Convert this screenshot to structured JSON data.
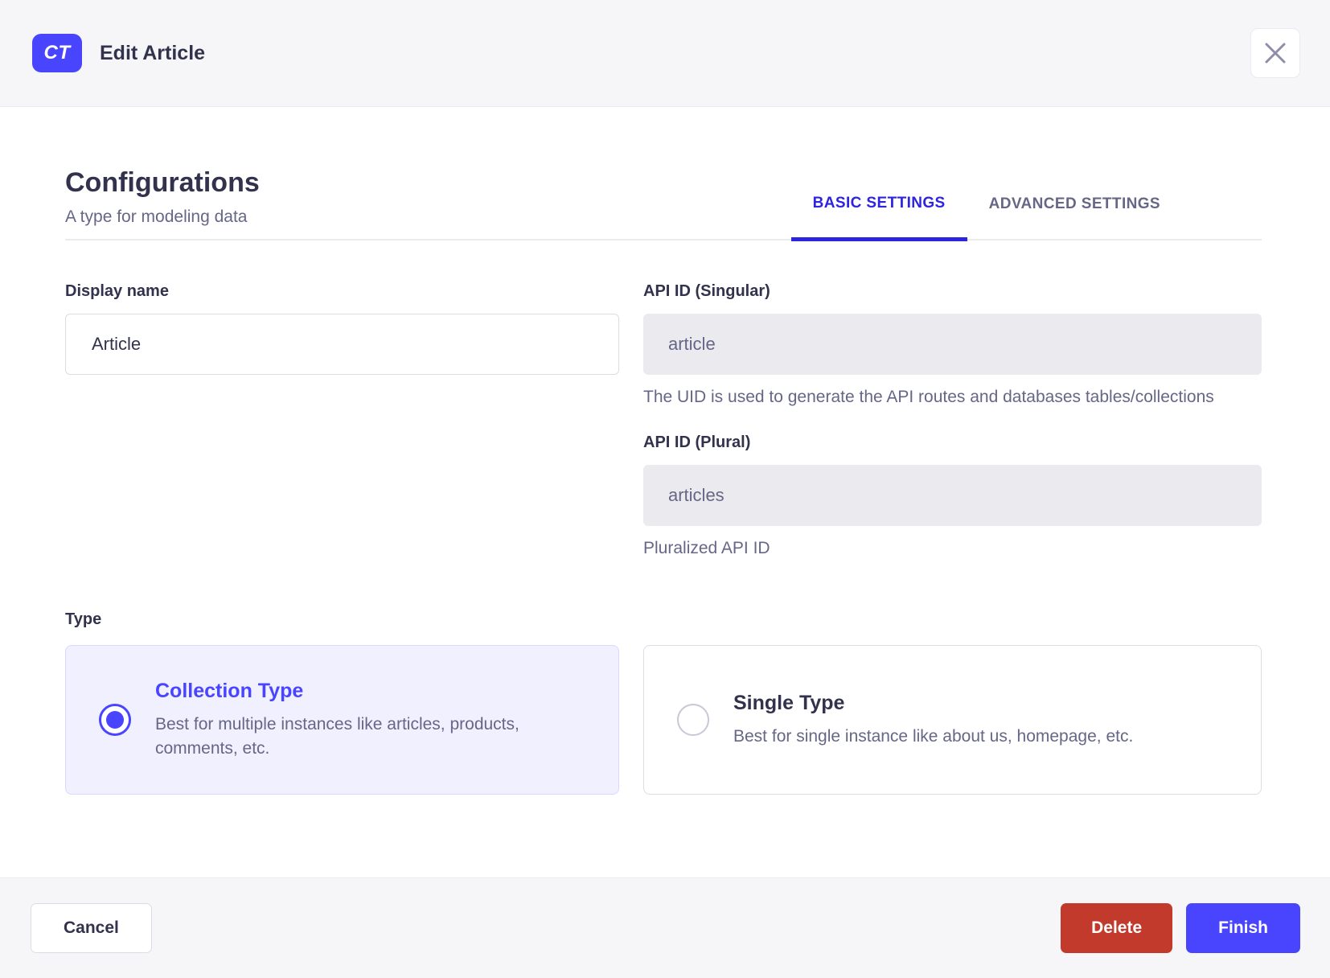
{
  "header": {
    "badge": "CT",
    "title": "Edit Article"
  },
  "config": {
    "title": "Configurations",
    "subtitle": "A type for modeling data",
    "tabs": [
      {
        "label": "BASIC SETTINGS",
        "active": true
      },
      {
        "label": "ADVANCED SETTINGS",
        "active": false
      }
    ]
  },
  "form": {
    "display_name": {
      "label": "Display name",
      "value": "Article"
    },
    "api_id_singular": {
      "label": "API ID (Singular)",
      "value": "article",
      "hint": "The UID is used to generate the API routes and databases tables/collections"
    },
    "api_id_plural": {
      "label": "API ID (Plural)",
      "value": "articles",
      "hint": "Pluralized API ID"
    },
    "type": {
      "label": "Type",
      "options": [
        {
          "title": "Collection Type",
          "description": "Best for multiple instances like articles, products, comments, etc.",
          "selected": true
        },
        {
          "title": "Single Type",
          "description": "Best for single instance like about us, homepage, etc.",
          "selected": false
        }
      ]
    }
  },
  "footer": {
    "cancel": "Cancel",
    "delete": "Delete",
    "finish": "Finish"
  },
  "colors": {
    "primary": "#4945ff",
    "tab-active": "#2d24e0",
    "danger": "#c23a2b",
    "text-dark": "#32324d",
    "text-muted": "#666687",
    "selected-bg": "#f0f0ff",
    "chrome-bg": "#f6f6f9"
  }
}
